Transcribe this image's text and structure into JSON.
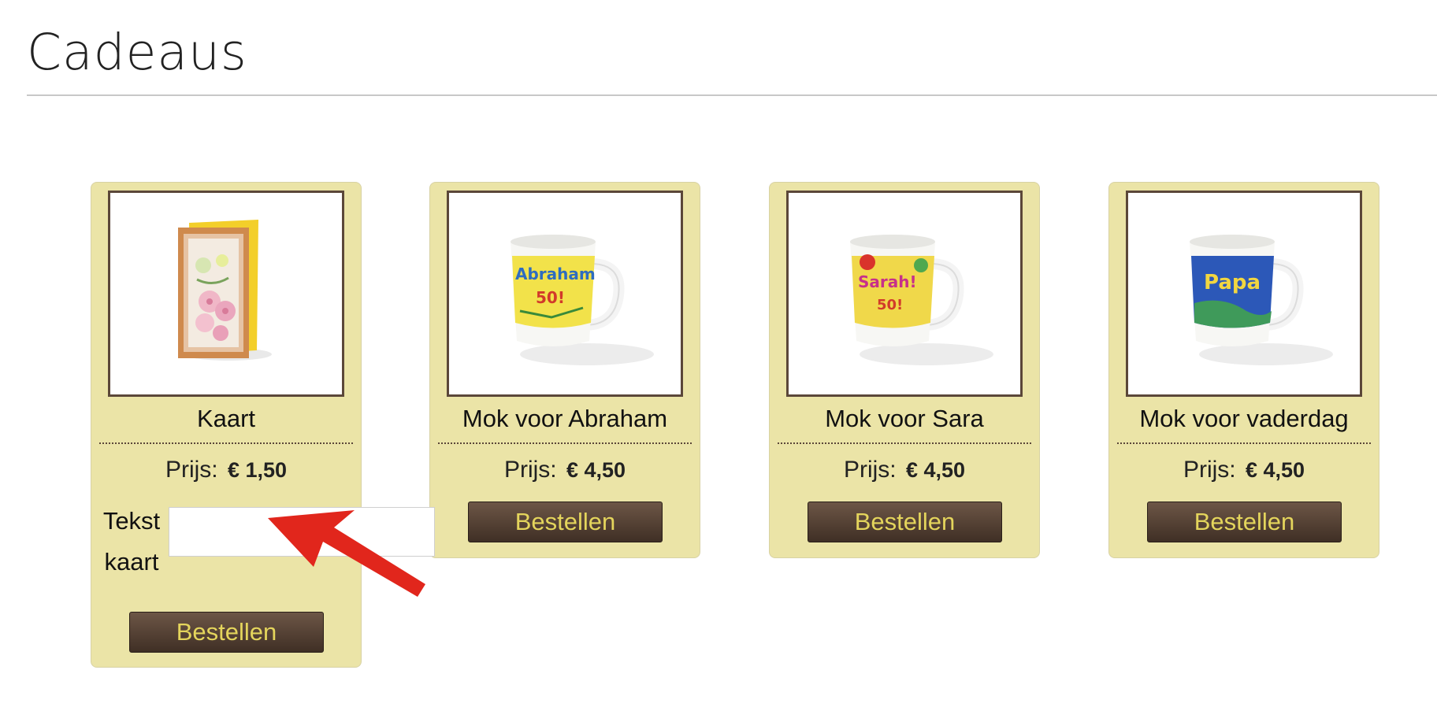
{
  "page": {
    "title": "Cadeaus"
  },
  "products": [
    {
      "name": "Kaart",
      "price_label": "Prijs:",
      "price": "€ 1,50",
      "order_label": "Bestellen",
      "text_card_label": "Tekst kaart",
      "text_card_value": "",
      "image_icon": "greeting-card-image"
    },
    {
      "name": "Mok voor Abraham",
      "price_label": "Prijs:",
      "price": "€ 4,50",
      "order_label": "Bestellen",
      "image_icon": "mug-image",
      "mug_text": "Abraham",
      "mug_number": "50!"
    },
    {
      "name": "Mok voor Sara",
      "price_label": "Prijs:",
      "price": "€ 4,50",
      "order_label": "Bestellen",
      "image_icon": "mug-image",
      "mug_text": "Sarah!",
      "mug_number": "50!"
    },
    {
      "name": "Mok voor vaderdag",
      "price_label": "Prijs:",
      "price": "€ 4,50",
      "order_label": "Bestellen",
      "image_icon": "mug-image",
      "mug_text": "Papa"
    }
  ],
  "colors": {
    "card_background": "#ebe4a7",
    "button_background": "#4f3d31",
    "button_text": "#e4d55c",
    "frame": "#5b4739",
    "annotation_arrow": "#e1261c"
  }
}
